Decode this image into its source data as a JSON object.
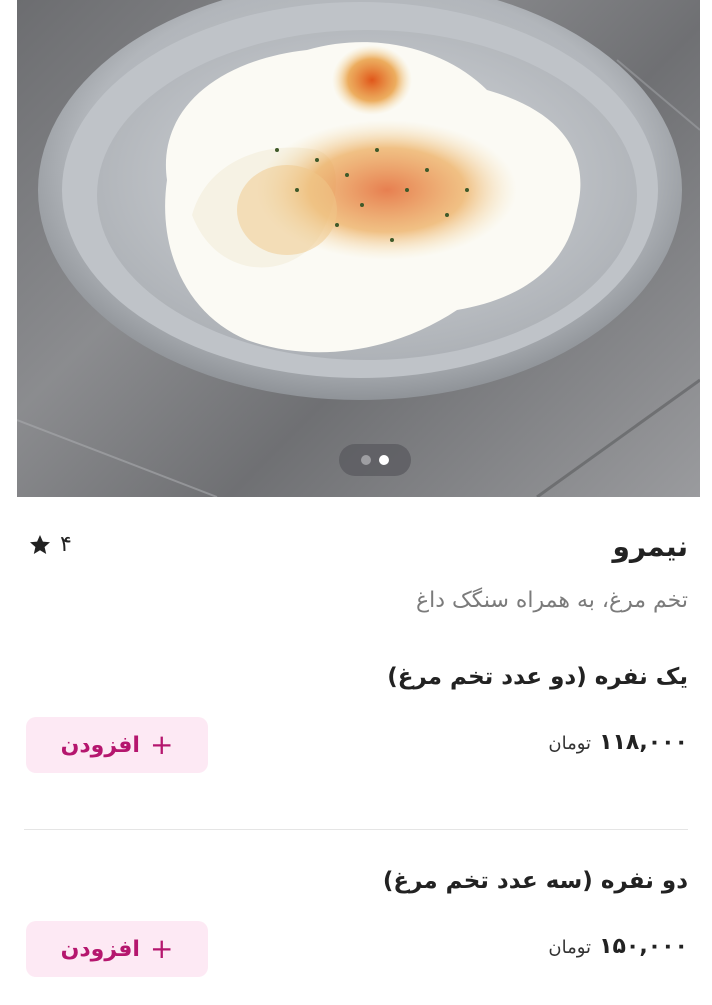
{
  "gallery": {
    "image_alt": "fried eggs in a metal pan",
    "total_slides": 2,
    "active_slide": 2
  },
  "product": {
    "title": "نیمرو",
    "rating": "۴",
    "description": "تخم مرغ، به همراه سنگک داغ"
  },
  "options": [
    {
      "name": "یک نفره (دو عدد تخم مرغ)",
      "price": "۱۱۸,۰۰۰",
      "currency": "تومان",
      "add_label": "افزودن"
    },
    {
      "name": "دو نفره (سه عدد تخم مرغ)",
      "price": "۱۵۰,۰۰۰",
      "currency": "تومان",
      "add_label": "افزودن"
    }
  ],
  "colors": {
    "accent": "#b5166e",
    "button_bg": "#fde9f4",
    "muted_text": "#7b7b7b"
  }
}
